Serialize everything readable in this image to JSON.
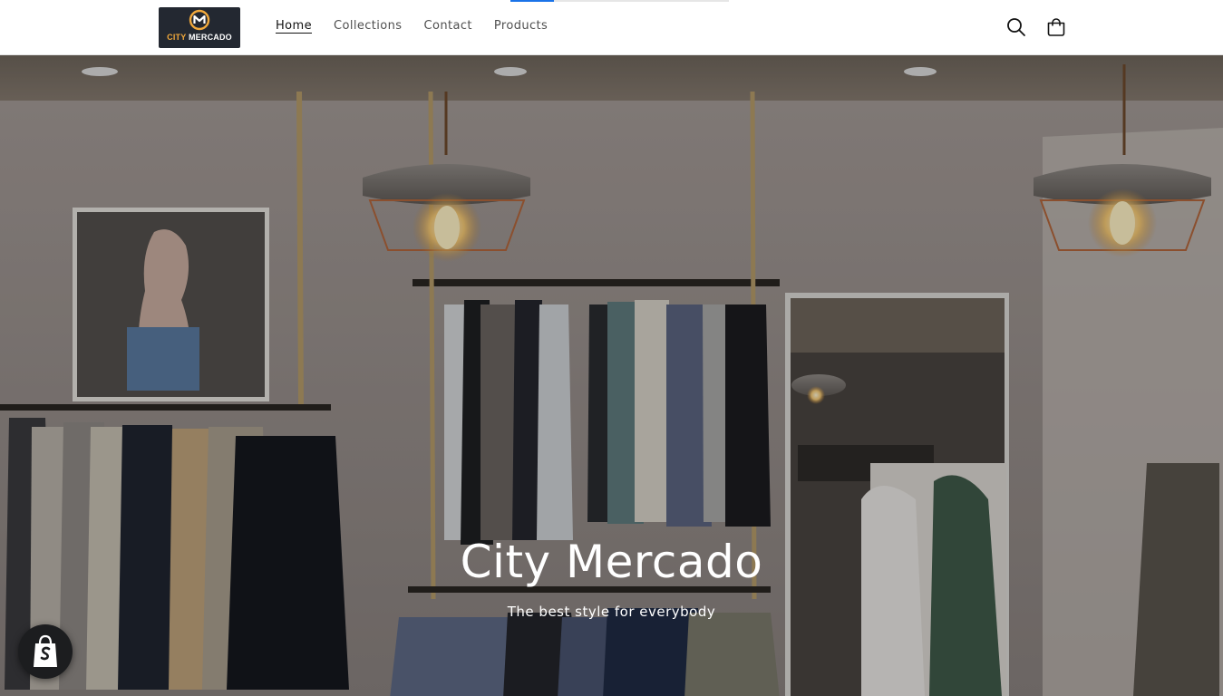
{
  "header": {
    "logo": {
      "word1": "CITY",
      "word2": "MERCADO",
      "brand_colors": {
        "accent": "#f2a93b",
        "background": "#232831"
      }
    },
    "nav": [
      {
        "label": "Home",
        "active": true
      },
      {
        "label": "Collections",
        "active": false
      },
      {
        "label": "Contact",
        "active": false
      },
      {
        "label": "Products",
        "active": false
      }
    ],
    "icons": {
      "search": "search-icon",
      "cart": "cart-icon"
    }
  },
  "page_load_progress": 0.2,
  "hero": {
    "title": "City Mercado",
    "subtitle": "The best style for everybody"
  },
  "floating_badge": {
    "icon": "shopify-bag-icon"
  }
}
